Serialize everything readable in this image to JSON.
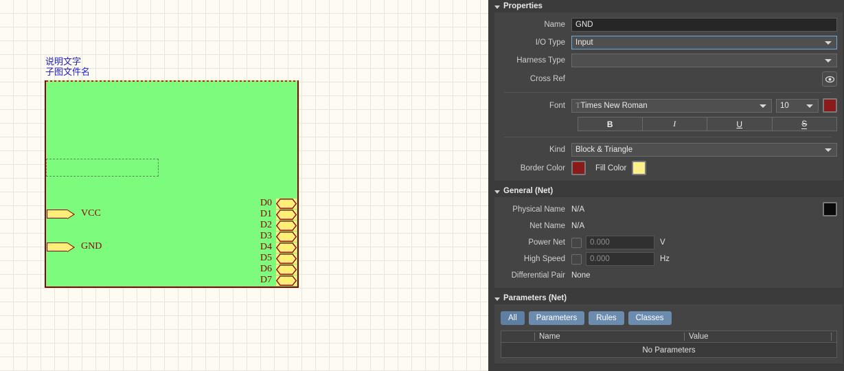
{
  "canvas": {
    "sheet_labels": {
      "description": "说明文字",
      "filename": "子图文件名"
    },
    "left_ports": [
      {
        "label": "VCC"
      },
      {
        "label": "GND"
      }
    ],
    "right_ports": [
      {
        "label": "D0"
      },
      {
        "label": "D1"
      },
      {
        "label": "D2"
      },
      {
        "label": "D3"
      },
      {
        "label": "D4"
      },
      {
        "label": "D5"
      },
      {
        "label": "D6"
      },
      {
        "label": "D7"
      }
    ],
    "colors": {
      "block_fill": "#7dfb7d",
      "block_border": "#8b0000",
      "port_fill": "#ffef7a",
      "label_text": "#2020c8",
      "grid": "#e7e6dd",
      "background": "#fdfbf2"
    }
  },
  "panel": {
    "properties": {
      "title": "Properties",
      "name_label": "Name",
      "name_value": "GND",
      "io_type_label": "I/O Type",
      "io_type_value": "Input",
      "harness_type_label": "Harness Type",
      "harness_type_value": "",
      "cross_ref_label": "Cross Ref",
      "cross_ref_icon": "eye-icon",
      "font_label": "Font",
      "font_family": "Times New Roman",
      "font_size": "10",
      "font_color": "#8b1a1a",
      "style_bold": "B",
      "style_italic": "I",
      "style_underline": "U",
      "style_strikethrough": "S",
      "kind_label": "Kind",
      "kind_value": "Block & Triangle",
      "border_color_label": "Border Color",
      "border_color": "#8b1a1a",
      "fill_color_label": "Fill Color",
      "fill_color": "#fdf08a"
    },
    "general_net": {
      "title": "General (Net)",
      "physical_name_label": "Physical Name",
      "physical_name_value": "N/A",
      "net_name_label": "Net Name",
      "net_name_value": "N/A",
      "power_net_label": "Power Net",
      "power_net_value": "0.000",
      "power_net_unit": "V",
      "high_speed_label": "High Speed",
      "high_speed_value": "0.000",
      "high_speed_unit": "Hz",
      "differential_pair_label": "Differential Pair",
      "differential_pair_value": "None",
      "net_color": "#0a0a0a"
    },
    "parameters_net": {
      "title": "Parameters (Net)",
      "tabs": [
        {
          "label": "All",
          "active": true
        },
        {
          "label": "Parameters",
          "active": false
        },
        {
          "label": "Rules",
          "active": false
        },
        {
          "label": "Classes",
          "active": false
        }
      ],
      "columns": [
        "Name",
        "Value"
      ],
      "empty_text": "No Parameters"
    }
  }
}
